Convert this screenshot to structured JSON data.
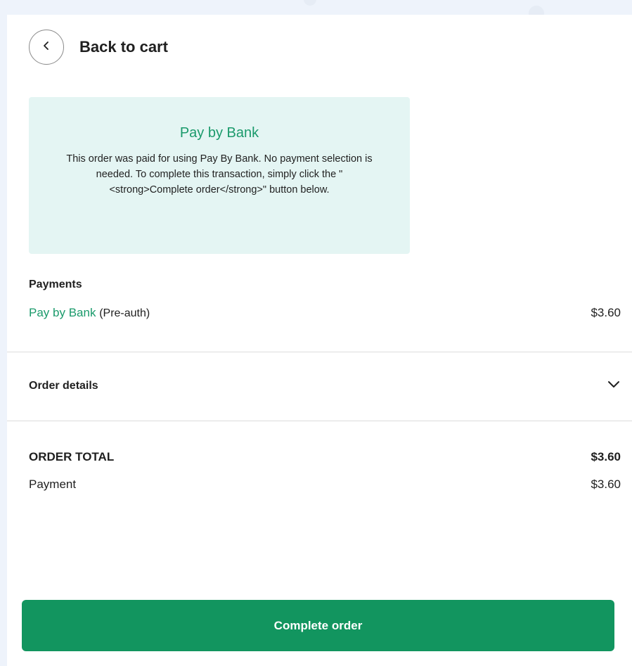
{
  "header": {
    "back_label": "Back to cart"
  },
  "notice": {
    "title": "Pay by Bank",
    "text": "This order was paid for using Pay By Bank. No payment selection is needed. To complete this transaction, simply click the \"<strong>Complete order</strong>\" button below."
  },
  "payments": {
    "heading": "Payments",
    "items": [
      {
        "method": "Pay by Bank",
        "note": "(Pre-auth)",
        "amount": "$3.60"
      }
    ]
  },
  "order_details": {
    "label": "Order details"
  },
  "summary": {
    "total_label": "ORDER TOTAL",
    "total_value": "$3.60",
    "payment_label": "Payment",
    "payment_value": "$3.60"
  },
  "actions": {
    "complete_label": "Complete order"
  },
  "colors": {
    "accent": "#12955f",
    "notice_bg": "#e4f5f3",
    "page_bg": "#eef3fb"
  },
  "icons": {
    "back": "chevron-left-icon",
    "expand": "chevron-down-icon"
  }
}
